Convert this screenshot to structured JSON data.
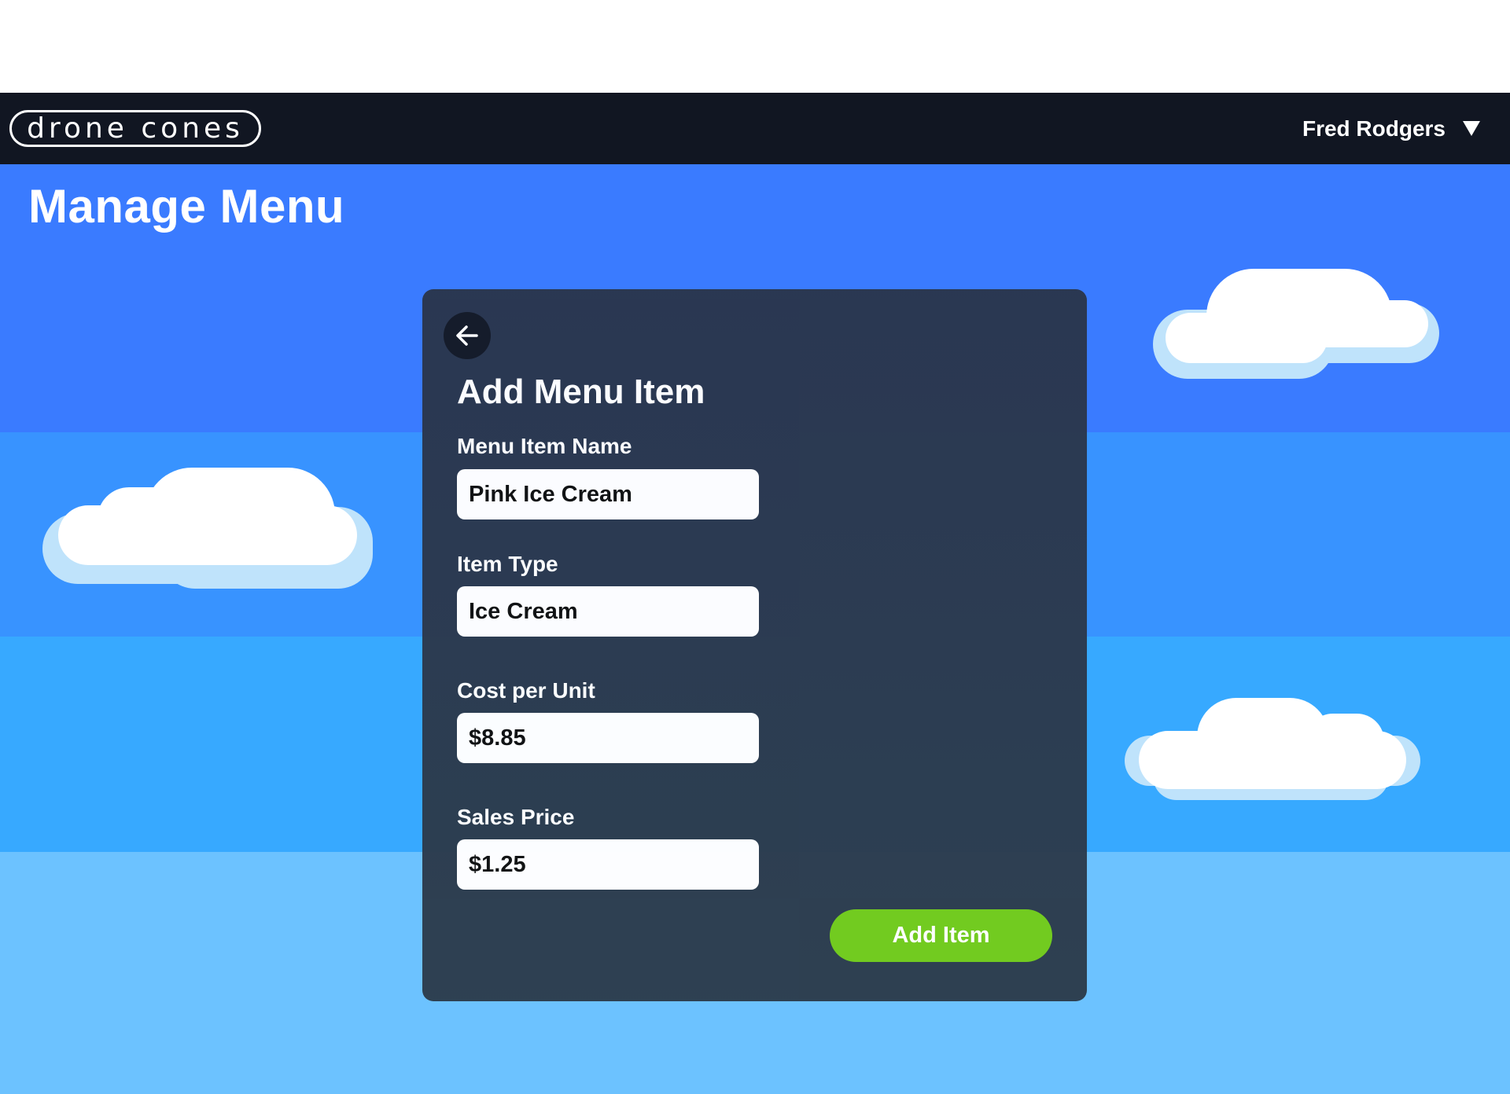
{
  "app": {
    "logo_text": "Drone Cones",
    "user_name": "Fred Rodgers"
  },
  "page": {
    "title": "Manage Menu"
  },
  "form": {
    "title": "Add Menu Item",
    "fields": {
      "name": {
        "label": "Menu Item Name",
        "value": "Pink Ice Cream"
      },
      "type": {
        "label": "Item Type",
        "value": "Ice Cream"
      },
      "cost": {
        "label": "Cost per Unit",
        "value": "$8.85"
      },
      "price": {
        "label": "Sales Price",
        "value": "$1.25"
      }
    },
    "submit_label": "Add Item"
  },
  "icons": {
    "back": "arrow-left-icon",
    "user_menu": "caret-down-icon"
  },
  "colors": {
    "navbar": "#111622",
    "sky_band_1": "#3a7bff",
    "sky_band_2": "#3893ff",
    "sky_band_3": "#37a9ff",
    "sky_band_4": "#6cc2ff",
    "card": "#2b3a4f",
    "accent_button": "#73cc1c",
    "cloud": "#ffffff",
    "cloud_shadow": "#bfe3fb"
  }
}
